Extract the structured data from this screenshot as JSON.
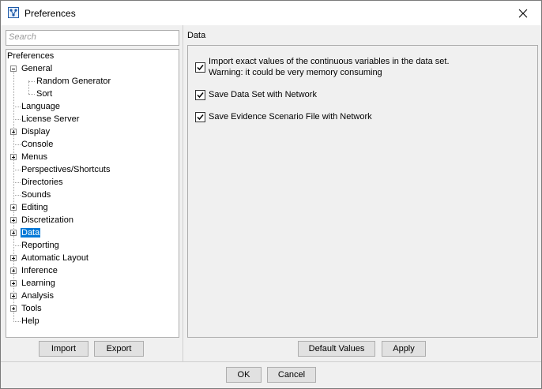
{
  "window": {
    "title": "Preferences"
  },
  "search": {
    "placeholder": "Search"
  },
  "tree": {
    "root": "Preferences",
    "items": [
      {
        "label": "General"
      },
      {
        "label": "Random Generator"
      },
      {
        "label": "Sort"
      },
      {
        "label": "Language"
      },
      {
        "label": "License Server"
      },
      {
        "label": "Display"
      },
      {
        "label": "Console"
      },
      {
        "label": "Menus"
      },
      {
        "label": "Perspectives/Shortcuts"
      },
      {
        "label": "Directories"
      },
      {
        "label": "Sounds"
      },
      {
        "label": "Editing"
      },
      {
        "label": "Discretization"
      },
      {
        "label": "Data"
      },
      {
        "label": "Reporting"
      },
      {
        "label": "Automatic Layout"
      },
      {
        "label": "Inference"
      },
      {
        "label": "Learning"
      },
      {
        "label": "Analysis"
      },
      {
        "label": "Tools"
      },
      {
        "label": "Help"
      }
    ],
    "selected": "Data"
  },
  "left_buttons": {
    "import": "Import",
    "export": "Export"
  },
  "panel": {
    "title": "Data",
    "options": [
      {
        "line1": "Import exact values of the continuous variables in the data set.",
        "line2": "Warning: it could be very memory consuming",
        "checked": true
      },
      {
        "line1": "Save Data Set with Network",
        "checked": true
      },
      {
        "line1": "Save Evidence Scenario File with Network",
        "checked": true
      }
    ],
    "default_values": "Default Values",
    "apply": "Apply"
  },
  "footer": {
    "ok": "OK",
    "cancel": "Cancel"
  },
  "colors": {
    "selection": "#0078d7",
    "window_bg": "#f0f0f0",
    "button_bg": "#e1e1e1"
  }
}
